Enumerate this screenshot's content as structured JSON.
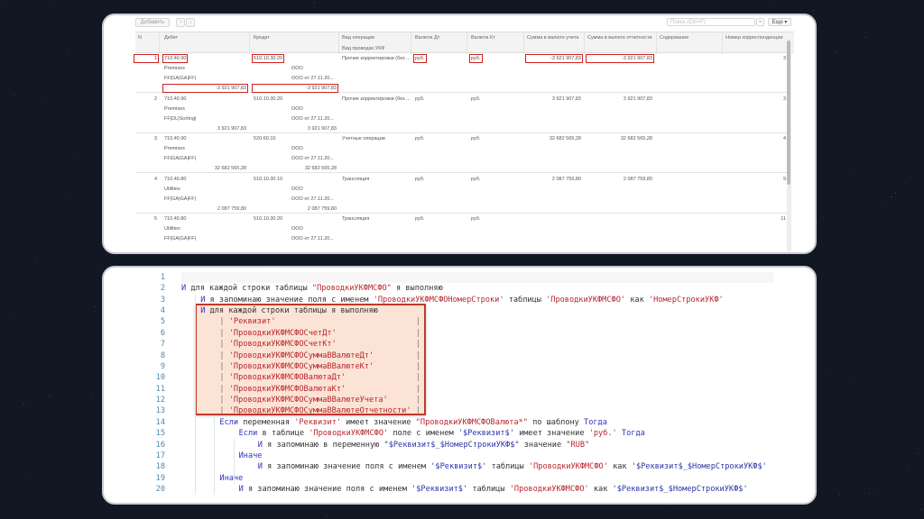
{
  "toolbar": {
    "add_label": "Добавить",
    "up_icon": "arrow-up-icon",
    "down_icon": "arrow-down-icon",
    "search_placeholder": "Поиск (Ctrl+F)",
    "clear_label": "×",
    "more_label": "Еще ▾"
  },
  "columns": {
    "n": "N",
    "debit": "Дебет",
    "credit": "Кредит",
    "op_type": "Вид операции",
    "ukf_type": "Вид проводки УКФ",
    "cur_dt": "Валюта Дт",
    "cur_kt": "Валюта Кт",
    "sum_acc": "Сумма в валюте учета",
    "sum_rep": "Сумма в валюте отчетности",
    "content": "Содержание",
    "corr": "Номер корреспонденции"
  },
  "rows": [
    {
      "n": "1",
      "debit": "710.40.90",
      "debit_sub1": "Premises",
      "debit_sub2": "FF|GA|GA|FF|",
      "debit_amount": "-3 921 907,83",
      "credit": "510.10.30.20",
      "credit_sub1": "ООО",
      "credit_sub2": "ООО от 27.11.20...",
      "credit_amount": "-3 921 907,83",
      "op_type": "Прочие корректировки (без ...",
      "cur_dt": "руб.",
      "cur_kt": "руб.",
      "sum_acc": "-3 921 907,83",
      "sum_rep": "-3 921 907,83",
      "content": "",
      "corr": "3",
      "highlight": true
    },
    {
      "n": "2",
      "debit": "710.40.90",
      "debit_sub1": "Premises",
      "debit_sub2": "FF|DL|Sorting|",
      "debit_amount": "3 921 907,83",
      "credit": "510.10.30.20",
      "credit_sub1": "ООО",
      "credit_sub2": "ООО от 27.11.20...",
      "credit_amount": "3 921 907,83",
      "op_type": "Прочие корректировки (без ...",
      "cur_dt": "руб.",
      "cur_kt": "руб.",
      "sum_acc": "3 921 907,83",
      "sum_rep": "3 921 907,83",
      "content": "",
      "corr": "3"
    },
    {
      "n": "3",
      "debit": "710.40.90",
      "debit_sub1": "Premises",
      "debit_sub2": "FF|GA|GA|FF|",
      "debit_amount": "32 682 565,28",
      "credit": "520.60.10",
      "credit_sub1": "ООО",
      "credit_sub2": "ООО от 27.11.20...",
      "credit_amount": "32 682 565,28",
      "op_type": "Учетные операции",
      "cur_dt": "руб.",
      "cur_kt": "руб.",
      "sum_acc": "32 682 565,28",
      "sum_rep": "32 682 565,28",
      "content": "",
      "corr": "4"
    },
    {
      "n": "4",
      "debit": "710.40.80",
      "debit_sub1": "Utilities",
      "debit_sub2": "FF|GA|GA|FF|",
      "debit_amount": "2 087 759,80",
      "credit": "510.10.30.10",
      "credit_sub1": "ООО",
      "credit_sub2": "ООО от 27.11.20...",
      "credit_amount": "2 087 759,80",
      "op_type": "Трансляция",
      "cur_dt": "руб.",
      "cur_kt": "руб.",
      "sum_acc": "2 087 759,80",
      "sum_rep": "2 087 759,80",
      "content": "",
      "corr": "9"
    },
    {
      "n": "5",
      "debit": "710.40.80",
      "debit_sub1": "Utilities",
      "debit_sub2": "FF|GA|GA|FF|",
      "debit_amount": "",
      "credit": "510.10.30.20",
      "credit_sub1": "ООО",
      "credit_sub2": "ООО от 27.11.20...",
      "credit_amount": "",
      "op_type": "Трансляция",
      "cur_dt": "руб.",
      "cur_kt": "руб.",
      "sum_acc": "",
      "sum_rep": "",
      "content": "",
      "corr": "11"
    }
  ],
  "code": {
    "highlight_color": "#c0392b",
    "lines": [
      {
        "num": "1",
        "indent": 0,
        "tokens": []
      },
      {
        "num": "2",
        "indent": 0,
        "tokens": [
          [
            "kw",
            "И"
          ],
          [
            "t",
            " для каждой строки таблицы "
          ],
          [
            "str",
            "\"ПроводкиУКФМСФО\""
          ],
          [
            "t",
            " я выполняю"
          ]
        ]
      },
      {
        "num": "3",
        "indent": 1,
        "tokens": [
          [
            "kw",
            "И"
          ],
          [
            "t",
            " я запоминаю значение поля с именем "
          ],
          [
            "str",
            "'ПроводкиУКФМСФОНомерСтроки'"
          ],
          [
            "t",
            " таблицы "
          ],
          [
            "str",
            "'ПроводкиУКФМСФО'"
          ],
          [
            "t",
            " как "
          ],
          [
            "str",
            "'НомерСтрокиУКФ'"
          ]
        ]
      },
      {
        "num": "4",
        "indent": 1,
        "tokens": [
          [
            "kw",
            "И"
          ],
          [
            "t",
            " для каждой строки таблицы я выполняю"
          ]
        ]
      },
      {
        "num": "5",
        "indent": 2,
        "cell": "'Реквизит'"
      },
      {
        "num": "6",
        "indent": 2,
        "cell": "'ПроводкиУКФМСФОСчетДт'"
      },
      {
        "num": "7",
        "indent": 2,
        "cell": "'ПроводкиУКФМСФОСчетКт'"
      },
      {
        "num": "8",
        "indent": 2,
        "cell": "'ПроводкиУКФМСФОСуммаВВалютеДт'"
      },
      {
        "num": "9",
        "indent": 2,
        "cell": "'ПроводкиУКФМСФОСуммаВВалютеКт'"
      },
      {
        "num": "10",
        "indent": 2,
        "cell": "'ПроводкиУКФМСФОВалютаДт'"
      },
      {
        "num": "11",
        "indent": 2,
        "cell": "'ПроводкиУКФМСФОВалютаКт'"
      },
      {
        "num": "12",
        "indent": 2,
        "cell": "'ПроводкиУКФМСФОСуммаВВалютеУчета'"
      },
      {
        "num": "13",
        "indent": 2,
        "cell": "'ПроводкиУКФМСФОСуммаВВалютеОтчетности'"
      },
      {
        "num": "14",
        "indent": 2,
        "tokens": [
          [
            "kw",
            "Если"
          ],
          [
            "t",
            " переменная "
          ],
          [
            "str",
            "'Реквизит'"
          ],
          [
            "t",
            " имеет значение "
          ],
          [
            "str",
            "\"ПроводкиУКФМСФОВалюта*\""
          ],
          [
            "t",
            " по шаблону "
          ],
          [
            "kw",
            "Тогда"
          ]
        ]
      },
      {
        "num": "15",
        "indent": 3,
        "tokens": [
          [
            "kw",
            "Если"
          ],
          [
            "t",
            " в таблице "
          ],
          [
            "str",
            "'ПроводкиУКФМСФО'"
          ],
          [
            "t",
            " поле с именем "
          ],
          [
            "var",
            "'$Реквизит$'"
          ],
          [
            "t",
            " имеет значение "
          ],
          [
            "str",
            "'руб.'"
          ],
          [
            "t",
            " "
          ],
          [
            "kw",
            "Тогда"
          ]
        ]
      },
      {
        "num": "16",
        "indent": 4,
        "tokens": [
          [
            "kw",
            "И"
          ],
          [
            "t",
            " я запоминаю в переменную "
          ],
          [
            "var",
            "\"$Реквизит$_$НомерСтрокиУКФ$\""
          ],
          [
            "t",
            " значение "
          ],
          [
            "str",
            "\"RUB\""
          ]
        ]
      },
      {
        "num": "17",
        "indent": 3,
        "tokens": [
          [
            "kw",
            "Иначе"
          ]
        ]
      },
      {
        "num": "18",
        "indent": 4,
        "tokens": [
          [
            "kw",
            "И"
          ],
          [
            "t",
            " я запоминаю значение поля с именем "
          ],
          [
            "var",
            "'$Реквизит$'"
          ],
          [
            "t",
            " таблицы "
          ],
          [
            "str",
            "'ПроводкиУКФМСФО'"
          ],
          [
            "t",
            " как "
          ],
          [
            "var",
            "'$Реквизит$_$НомерСтрокиУКФ$'"
          ]
        ]
      },
      {
        "num": "19",
        "indent": 2,
        "tokens": [
          [
            "kw",
            "Иначе"
          ]
        ]
      },
      {
        "num": "20",
        "indent": 3,
        "tokens": [
          [
            "kw",
            "И"
          ],
          [
            "t",
            " я запоминаю значение поля с именем "
          ],
          [
            "var",
            "'$Реквизит$'"
          ],
          [
            "t",
            " таблицы "
          ],
          [
            "str",
            "'ПроводкиУКФМСФО'"
          ],
          [
            "t",
            " как "
          ],
          [
            "var",
            "'$Реквизит$_$НомерСтрокиУКФ$'"
          ]
        ]
      }
    ]
  }
}
